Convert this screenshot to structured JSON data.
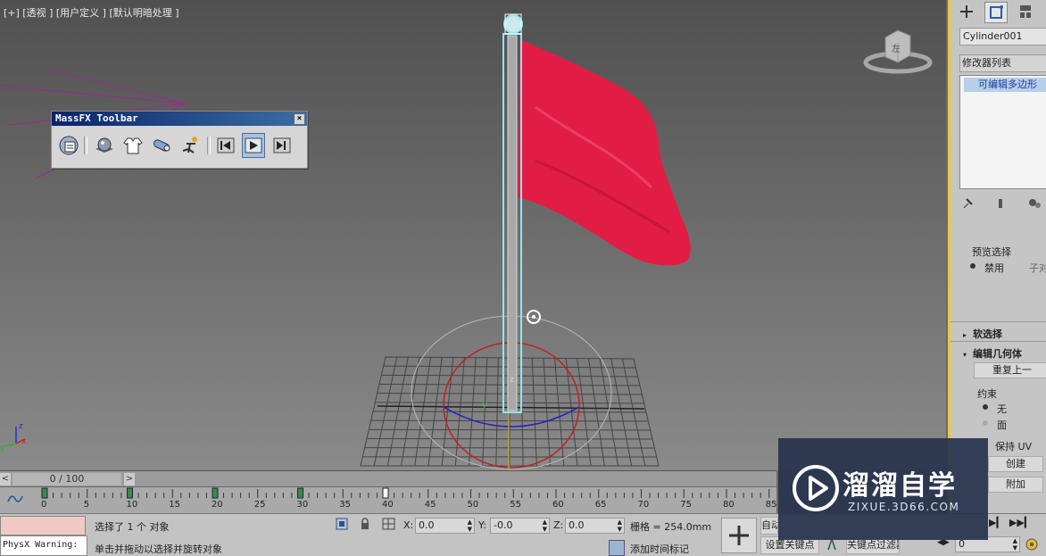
{
  "viewport": {
    "label": "[+] [透视 ] [用户定义 ] [默认明暗处理 ]",
    "viewcube_face": "左",
    "axis_labels": {
      "z": "z",
      "x": "x",
      "y": "y"
    }
  },
  "massfx_toolbar": {
    "title": "MassFX Toolbar",
    "close": "×",
    "buttons": [
      {
        "name": "world-parameters-icon"
      },
      {
        "name": "rigid-body-icon"
      },
      {
        "name": "cloth-icon"
      },
      {
        "name": "constraint-icon"
      },
      {
        "name": "ragdoll-icon"
      },
      {
        "name": "reset-simulation-icon"
      },
      {
        "name": "play-simulation-icon"
      },
      {
        "name": "step-simulation-icon"
      }
    ]
  },
  "command_panel": {
    "object_name": "Cylinder001",
    "modifier_list": "修改器列表",
    "stack_item": "可编辑多边形",
    "preview_selection_title": "预览选择",
    "preview_disabled": "禁用",
    "preview_subobj": "子对",
    "soft_selection": "软选择",
    "edit_geometry": "编辑几何体",
    "repeat_last": "重复上一",
    "constraints": "约束",
    "constraint_none": "无",
    "constraint_face": "面",
    "preserve_uv": "保持 UV",
    "create": "创建",
    "attach": "附加"
  },
  "timeline": {
    "slider_text": "0 / 100",
    "ticks": [
      "0",
      "5",
      "10",
      "15",
      "20",
      "25",
      "30",
      "35",
      "40",
      "45",
      "50",
      "55",
      "60",
      "65",
      "70",
      "75",
      "80",
      "85"
    ]
  },
  "status": {
    "maxscript_text": "PhysX Warning:",
    "selection_text": "选择了 1 个 对象",
    "prompt_text": "单击并拖动以选择并旋转对象",
    "x_label": "X:",
    "x_value": "0.0",
    "y_label": "Y:",
    "y_value": "-0.0",
    "z_label": "Z:",
    "z_value": "0.0",
    "grid_text": "栅格 = 254.0mm",
    "add_time_tag": "添加时间标记",
    "auto_key": "自动",
    "set_key": "设置关键点",
    "key_filters": "关键点过滤器...",
    "frame_value": "0"
  },
  "watermark": {
    "title": "溜溜自学",
    "url": "ZIXUE.3D66.COM"
  },
  "colors": {
    "flag": "#e21d45",
    "selection": "#8ee6ee",
    "panel_accent": "#e8c93c"
  }
}
